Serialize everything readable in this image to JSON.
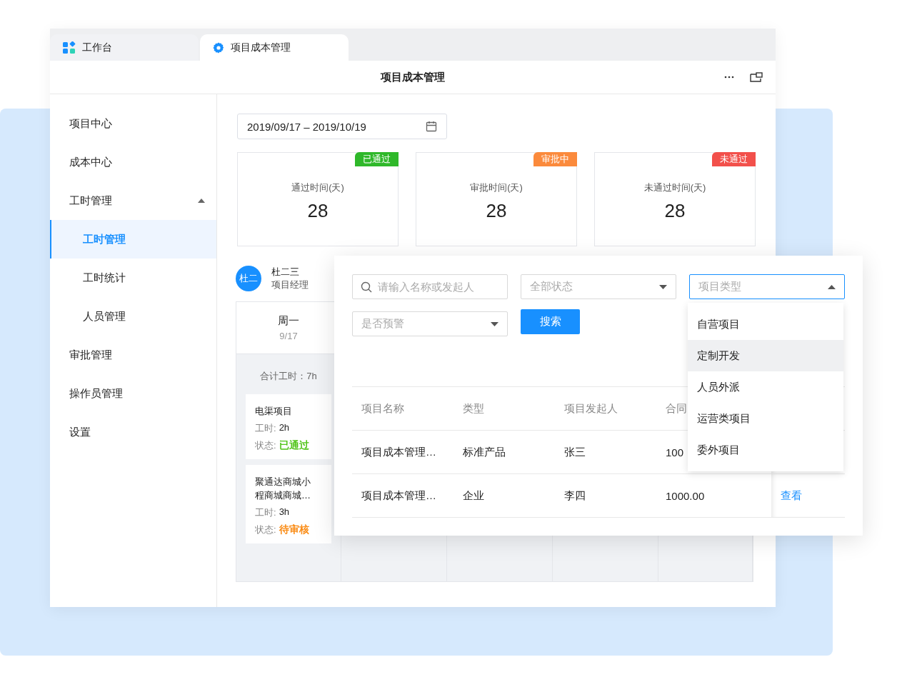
{
  "tabs": [
    {
      "label": "工作台",
      "selected": false,
      "kind": "apps"
    },
    {
      "label": "项目成本管理",
      "selected": true,
      "kind": "settings"
    }
  ],
  "header": {
    "title": "项目成本管理"
  },
  "sidebar": {
    "items": [
      {
        "label": "项目中心",
        "selected": false
      },
      {
        "label": "成本中心",
        "selected": false
      },
      {
        "label": "工时管理",
        "selected": false,
        "expanded": true,
        "children": [
          {
            "label": "工时管理",
            "selected": true
          },
          {
            "label": "工时统计",
            "selected": false
          },
          {
            "label": "人员管理",
            "selected": false
          }
        ]
      },
      {
        "label": "审批管理",
        "selected": false
      },
      {
        "label": "操作员管理",
        "selected": false
      },
      {
        "label": "设置",
        "selected": false
      }
    ]
  },
  "date_range": {
    "value": "2019/09/17 – 2019/10/19"
  },
  "stat_cards": [
    {
      "tag": "已通过",
      "color": "#2fb82a",
      "label": "通过时间(天)",
      "value": "28"
    },
    {
      "tag": "审批中",
      "color": "#fb8a3c",
      "label": "审批时间(天)",
      "value": "28"
    },
    {
      "tag": "未通过",
      "color": "#f2504b",
      "label": "未通过时间(天)",
      "value": "28"
    }
  ],
  "person": {
    "avatar_text": "杜二",
    "name": "杜二三",
    "role": "项目经理"
  },
  "calendar": {
    "columns": [
      {
        "day": "周一",
        "date": "9/17",
        "total": "合计工时：7h",
        "entries": [
          {
            "title": "电渠项目",
            "hours_label": "工时:",
            "hours": "2h",
            "status_label": "状态:",
            "status": "已通过",
            "color": "#52c41a"
          },
          {
            "title": "聚通达商城小程商城商城…",
            "hours_label": "工时:",
            "hours": "3h",
            "status_label": "状态:",
            "status": "待审核",
            "color": "#fa8c16"
          }
        ]
      }
    ]
  },
  "filter_panel": {
    "search": {
      "placeholder": "请输入名称或发起人"
    },
    "selects": [
      {
        "placeholder": "全部状态",
        "open": false
      },
      {
        "placeholder": "项目类型",
        "open": true
      },
      {
        "placeholder": "是否预警",
        "open": false
      }
    ],
    "search_button": "搜索",
    "dropdown": {
      "options": [
        {
          "label": "自营项目",
          "selected": false
        },
        {
          "label": "定制开发",
          "selected": true
        },
        {
          "label": "人员外派",
          "selected": false
        },
        {
          "label": "运营类项目",
          "selected": false
        },
        {
          "label": "委外项目",
          "selected": false
        }
      ]
    },
    "table": {
      "columns": [
        "项目名称",
        "类型",
        "项目发起人",
        "合同"
      ],
      "rows": [
        {
          "cells": [
            "项目成本管理…",
            "标准产品",
            "张三",
            "100"
          ]
        },
        {
          "cells": [
            "项目成本管理…",
            "企业",
            "李四",
            "1000.00"
          ],
          "action": "查看"
        }
      ]
    }
  }
}
